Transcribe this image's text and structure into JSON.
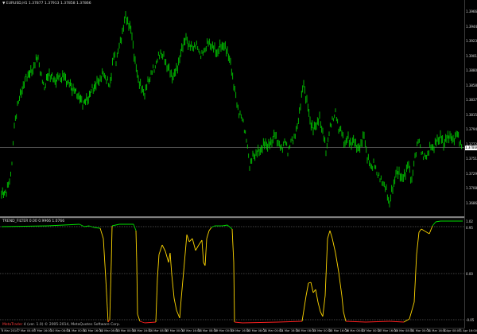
{
  "chart": {
    "title": "▼ EURUSD,H1  1.37877 1.37913 1.37858 1.37866",
    "current_price": "1.37866",
    "price_labels": [
      "1.39660",
      "1.39445",
      "1.39230",
      "1.39015",
      "1.38800",
      "1.38585",
      "1.38370",
      "1.38155",
      "1.37940",
      "1.37725",
      "1.37510",
      "1.37295",
      "1.37080",
      "1.36865"
    ],
    "time_labels": [
      "6 Mar 2014",
      "7 Mar 04:00",
      "7 Mar 16:00",
      "10 Mar 08:00",
      "11 Mar 00:00",
      "11 Mar 16:00",
      "12 Mar 08:00",
      "13 Mar 00:00",
      "13 Mar 16:00",
      "14 Mar 08:00",
      "17 Mar 00:00",
      "17 Mar 16:00",
      "18 Mar 08:00",
      "19 Mar 00:00",
      "19 Mar 16:00",
      "20 Mar 08:00",
      "21 Mar 00:00",
      "21 Mar 16:00",
      "24 Mar 08:00",
      "25 Mar 00:00",
      "25 Mar 16:00",
      "26 Mar 08:00",
      "27 Mar 00:00",
      "27 Mar 16:00",
      "28 Mar 08:00",
      "31 Mar 00:00",
      "31 Mar 16:00",
      "1 Apr 08:00",
      "1 Apr 16:00"
    ],
    "price_color": "#00e000",
    "grid_line_color": "#888888"
  },
  "indicator": {
    "title": "TREND_FILTER 0.00 0.9966 1.0766",
    "labels": [
      "1.02",
      "0.95",
      "0.00",
      "-0.05"
    ],
    "trend_up_color": "#00e000",
    "neutral_color": "#ffd700",
    "trend_down_color": "#ff2020"
  },
  "footer": {
    "brand": "MetaTrader",
    "text": " 4 (ver. 1.0)  © 2005-2014, MetaQuotes Software Corp."
  }
}
